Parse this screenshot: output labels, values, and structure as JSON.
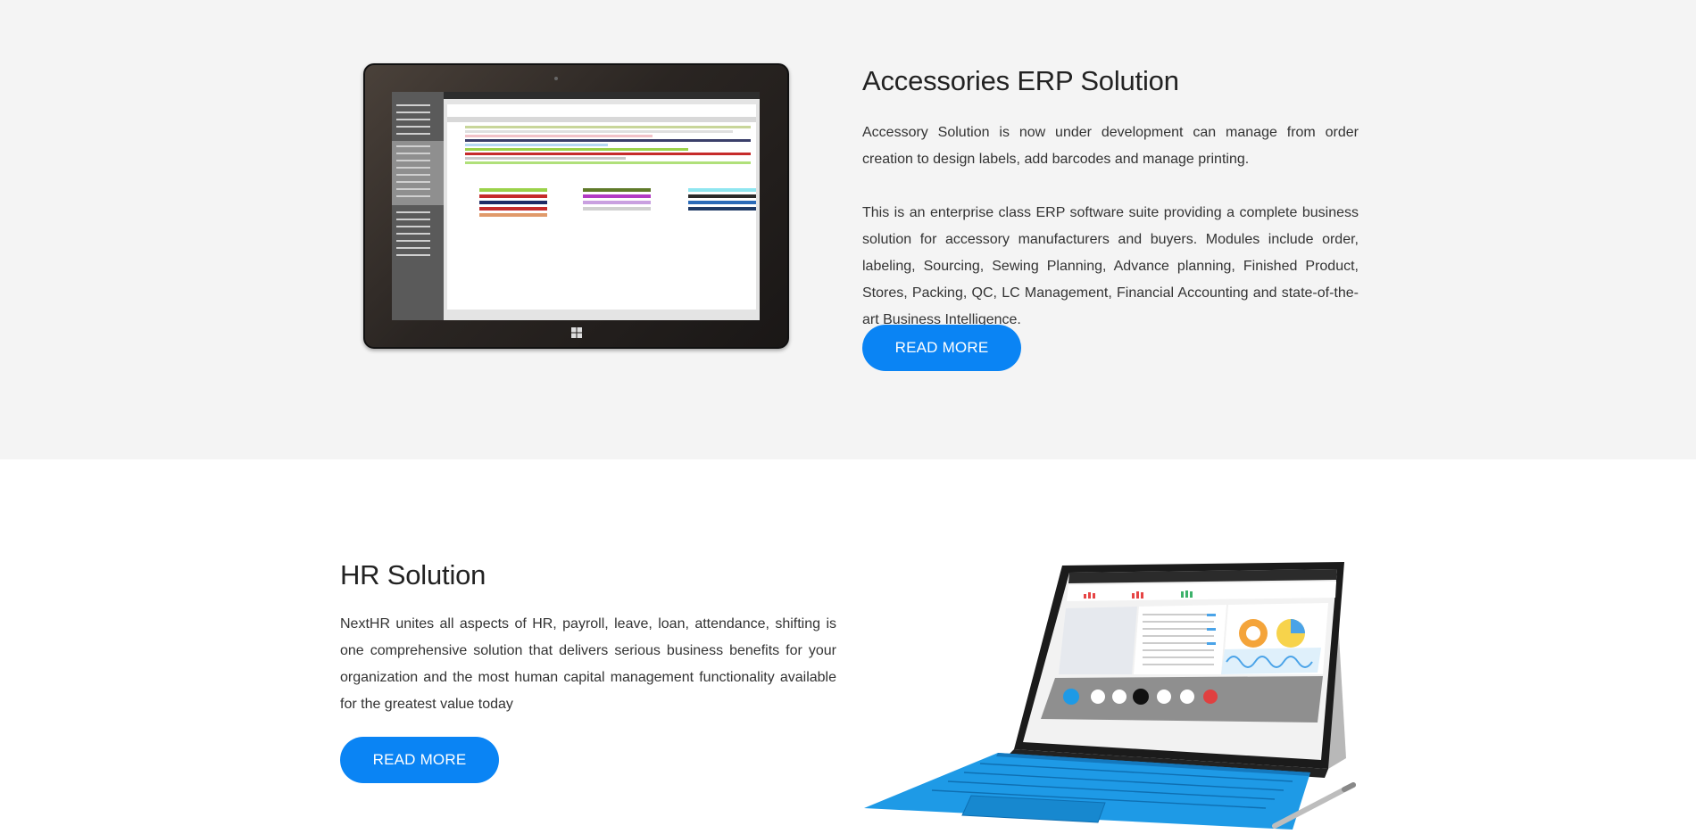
{
  "erp": {
    "title": "Accessories ERP Solution",
    "para1": "Accessory Solution is now under development can manage from order creation to design labels, add barcodes and manage printing.",
    "para2": "This is an enterprise class ERP software suite providing a complete business solution for accessory manufacturers and buyers. Modules include order, labeling, Sourcing, Sewing Planning, Advance planning, Finished Product, Stores, Packing, QC, LC Management, Financial Accounting and state-of-the-art Business Intelligence.",
    "button": "READ MORE"
  },
  "hr": {
    "title": "HR Solution",
    "para1": "NextHR unites all aspects of HR, payroll, leave, loan, attendance, shifting is one comprehensive solution that delivers serious business benefits for your organization and the most human capital management functionality available for the greatest value today",
    "button": "READ MORE"
  },
  "colors": {
    "accent": "#0a84f4",
    "section_bg": "#f4f4f4",
    "keyboard_blue": "#1e9ae6"
  },
  "icons": {
    "erp_image": "tablet-erp-screenshot",
    "hr_image": "surface-hr-dashboard",
    "windows_logo": "windows-logo-icon"
  }
}
